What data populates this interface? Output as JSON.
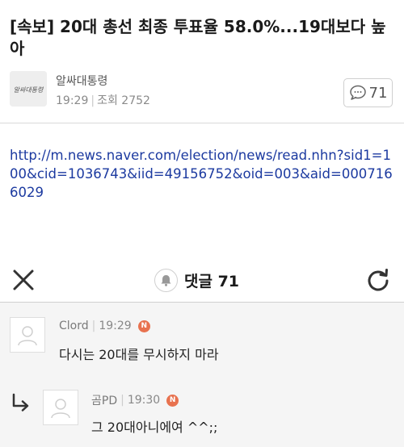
{
  "post": {
    "title": "[속보] 20대 총선 최종 투표율 58.0%...19대보다 높아",
    "author": "알싸대통령",
    "author_thumb_text": "알싸대통령",
    "time": "19:29",
    "views_label": "조회",
    "views": "2752",
    "comment_count": "71",
    "link": "http://m.news.naver.com/election/news/read.nhn?sid1=100&cid=1036743&iid=49156752&oid=003&aid=0007166029"
  },
  "comment_bar": {
    "title": "댓글 71"
  },
  "comments": [
    {
      "author": "Clord",
      "time": "19:29",
      "badge": "N",
      "text": "다시는 20대를 무시하지 마라",
      "is_reply": false
    },
    {
      "author": "곰PD",
      "time": "19:30",
      "badge": "N",
      "text": "그 20대아니에여 ^^;;",
      "is_reply": true
    }
  ],
  "icons": {
    "close": "close-icon",
    "bell": "bell-icon",
    "refresh": "refresh-icon",
    "speech": "speech-bubble-icon",
    "reply": "reply-arrow-icon"
  },
  "colors": {
    "link": "#1c3aa0",
    "badge": "#e8724f",
    "comments_bg": "#f5f5f5"
  }
}
